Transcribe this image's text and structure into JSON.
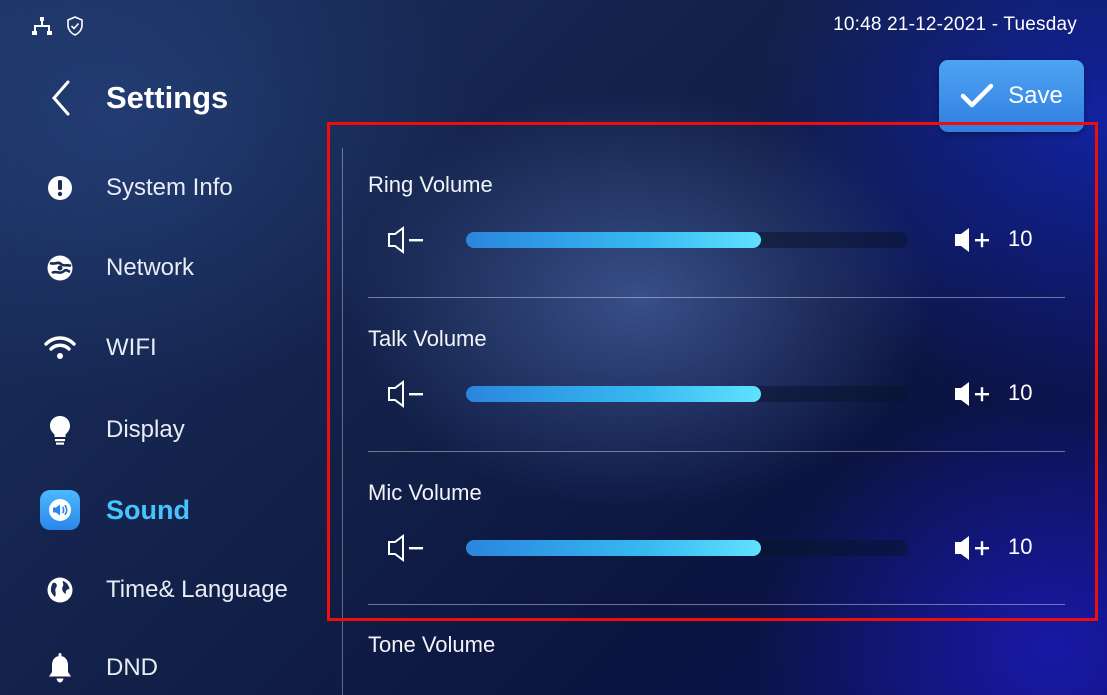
{
  "status_bar": {
    "icons": [
      "network-icon",
      "shield-icon"
    ],
    "datetime": "10:48  21-12-2021 - Tuesday"
  },
  "header": {
    "title": "Settings",
    "save_label": "Save"
  },
  "sidebar": {
    "items": [
      {
        "label": "System Info",
        "icon": "info-icon",
        "active": false
      },
      {
        "label": "Network",
        "icon": "network-globe-icon",
        "active": false
      },
      {
        "label": "WIFI",
        "icon": "wifi-icon",
        "active": false
      },
      {
        "label": "Display",
        "icon": "lightbulb-icon",
        "active": false
      },
      {
        "label": "Sound",
        "icon": "speaker-icon",
        "active": true
      },
      {
        "label": "Time& Language",
        "icon": "globe-icon",
        "active": false
      },
      {
        "label": "DND",
        "icon": "bell-icon",
        "active": false
      }
    ]
  },
  "volumes": [
    {
      "label": "Ring Volume",
      "value": "10",
      "level": 0.667
    },
    {
      "label": "Talk Volume",
      "value": "10",
      "level": 0.667
    },
    {
      "label": "Mic Volume",
      "value": "10",
      "level": 0.667
    },
    {
      "label": "Tone Volume"
    }
  ],
  "colors": {
    "accent": "#46c4ff",
    "save_button": "#3a8ee8",
    "highlight_border": "#f20d0d"
  }
}
